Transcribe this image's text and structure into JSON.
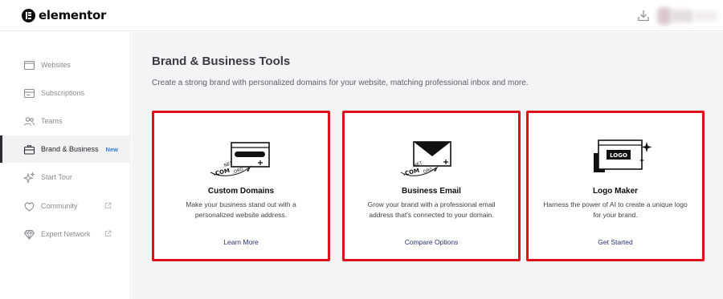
{
  "app": {
    "name": "elementor"
  },
  "topbar": {
    "download_icon": "download-icon",
    "avatar": "user-avatar"
  },
  "sidebar": {
    "items": [
      {
        "label": "Websites",
        "icon": "browser-window-icon",
        "active": false
      },
      {
        "label": "Subscriptions",
        "icon": "subscriptions-icon",
        "active": false
      },
      {
        "label": "Teams",
        "icon": "users-icon",
        "active": false
      },
      {
        "label": "Brand & Business",
        "icon": "briefcase-icon",
        "active": true,
        "badge": "New"
      },
      {
        "label": "Start Tour",
        "icon": "sparkles-icon",
        "active": false
      },
      {
        "label": "Community",
        "icon": "community-icon",
        "active": false,
        "external": true
      },
      {
        "label": "Expert Network",
        "icon": "diamond-icon",
        "active": false,
        "external": true
      }
    ]
  },
  "main": {
    "title": "Brand & Business Tools",
    "subtitle": "Create a strong brand with personalized domains for your website, matching professional inbox and more.",
    "cards": [
      {
        "title": "Custom Domains",
        "description": "Make your business stand out with a personalized website address.",
        "link": "Learn More",
        "illustration": "domain-browser-illustration",
        "illustration_tags": [
          ".COM",
          ".NET",
          ".ORG"
        ]
      },
      {
        "title": "Business Email",
        "description": "Grow your brand with a professional email address that's connected to your domain.",
        "link": "Compare Options",
        "illustration": "email-envelope-illustration",
        "illustration_tags": [
          ".COM",
          ".NET",
          ".ORG"
        ]
      },
      {
        "title": "Logo Maker",
        "description": "Harness the power of AI to create a unique logo for your brand.",
        "link": "Get Started",
        "illustration": "logo-maker-illustration",
        "illustration_tags": [
          "LOGO"
        ]
      }
    ],
    "highlight_color": "#e0101b",
    "link_color": "#2b2f76"
  }
}
